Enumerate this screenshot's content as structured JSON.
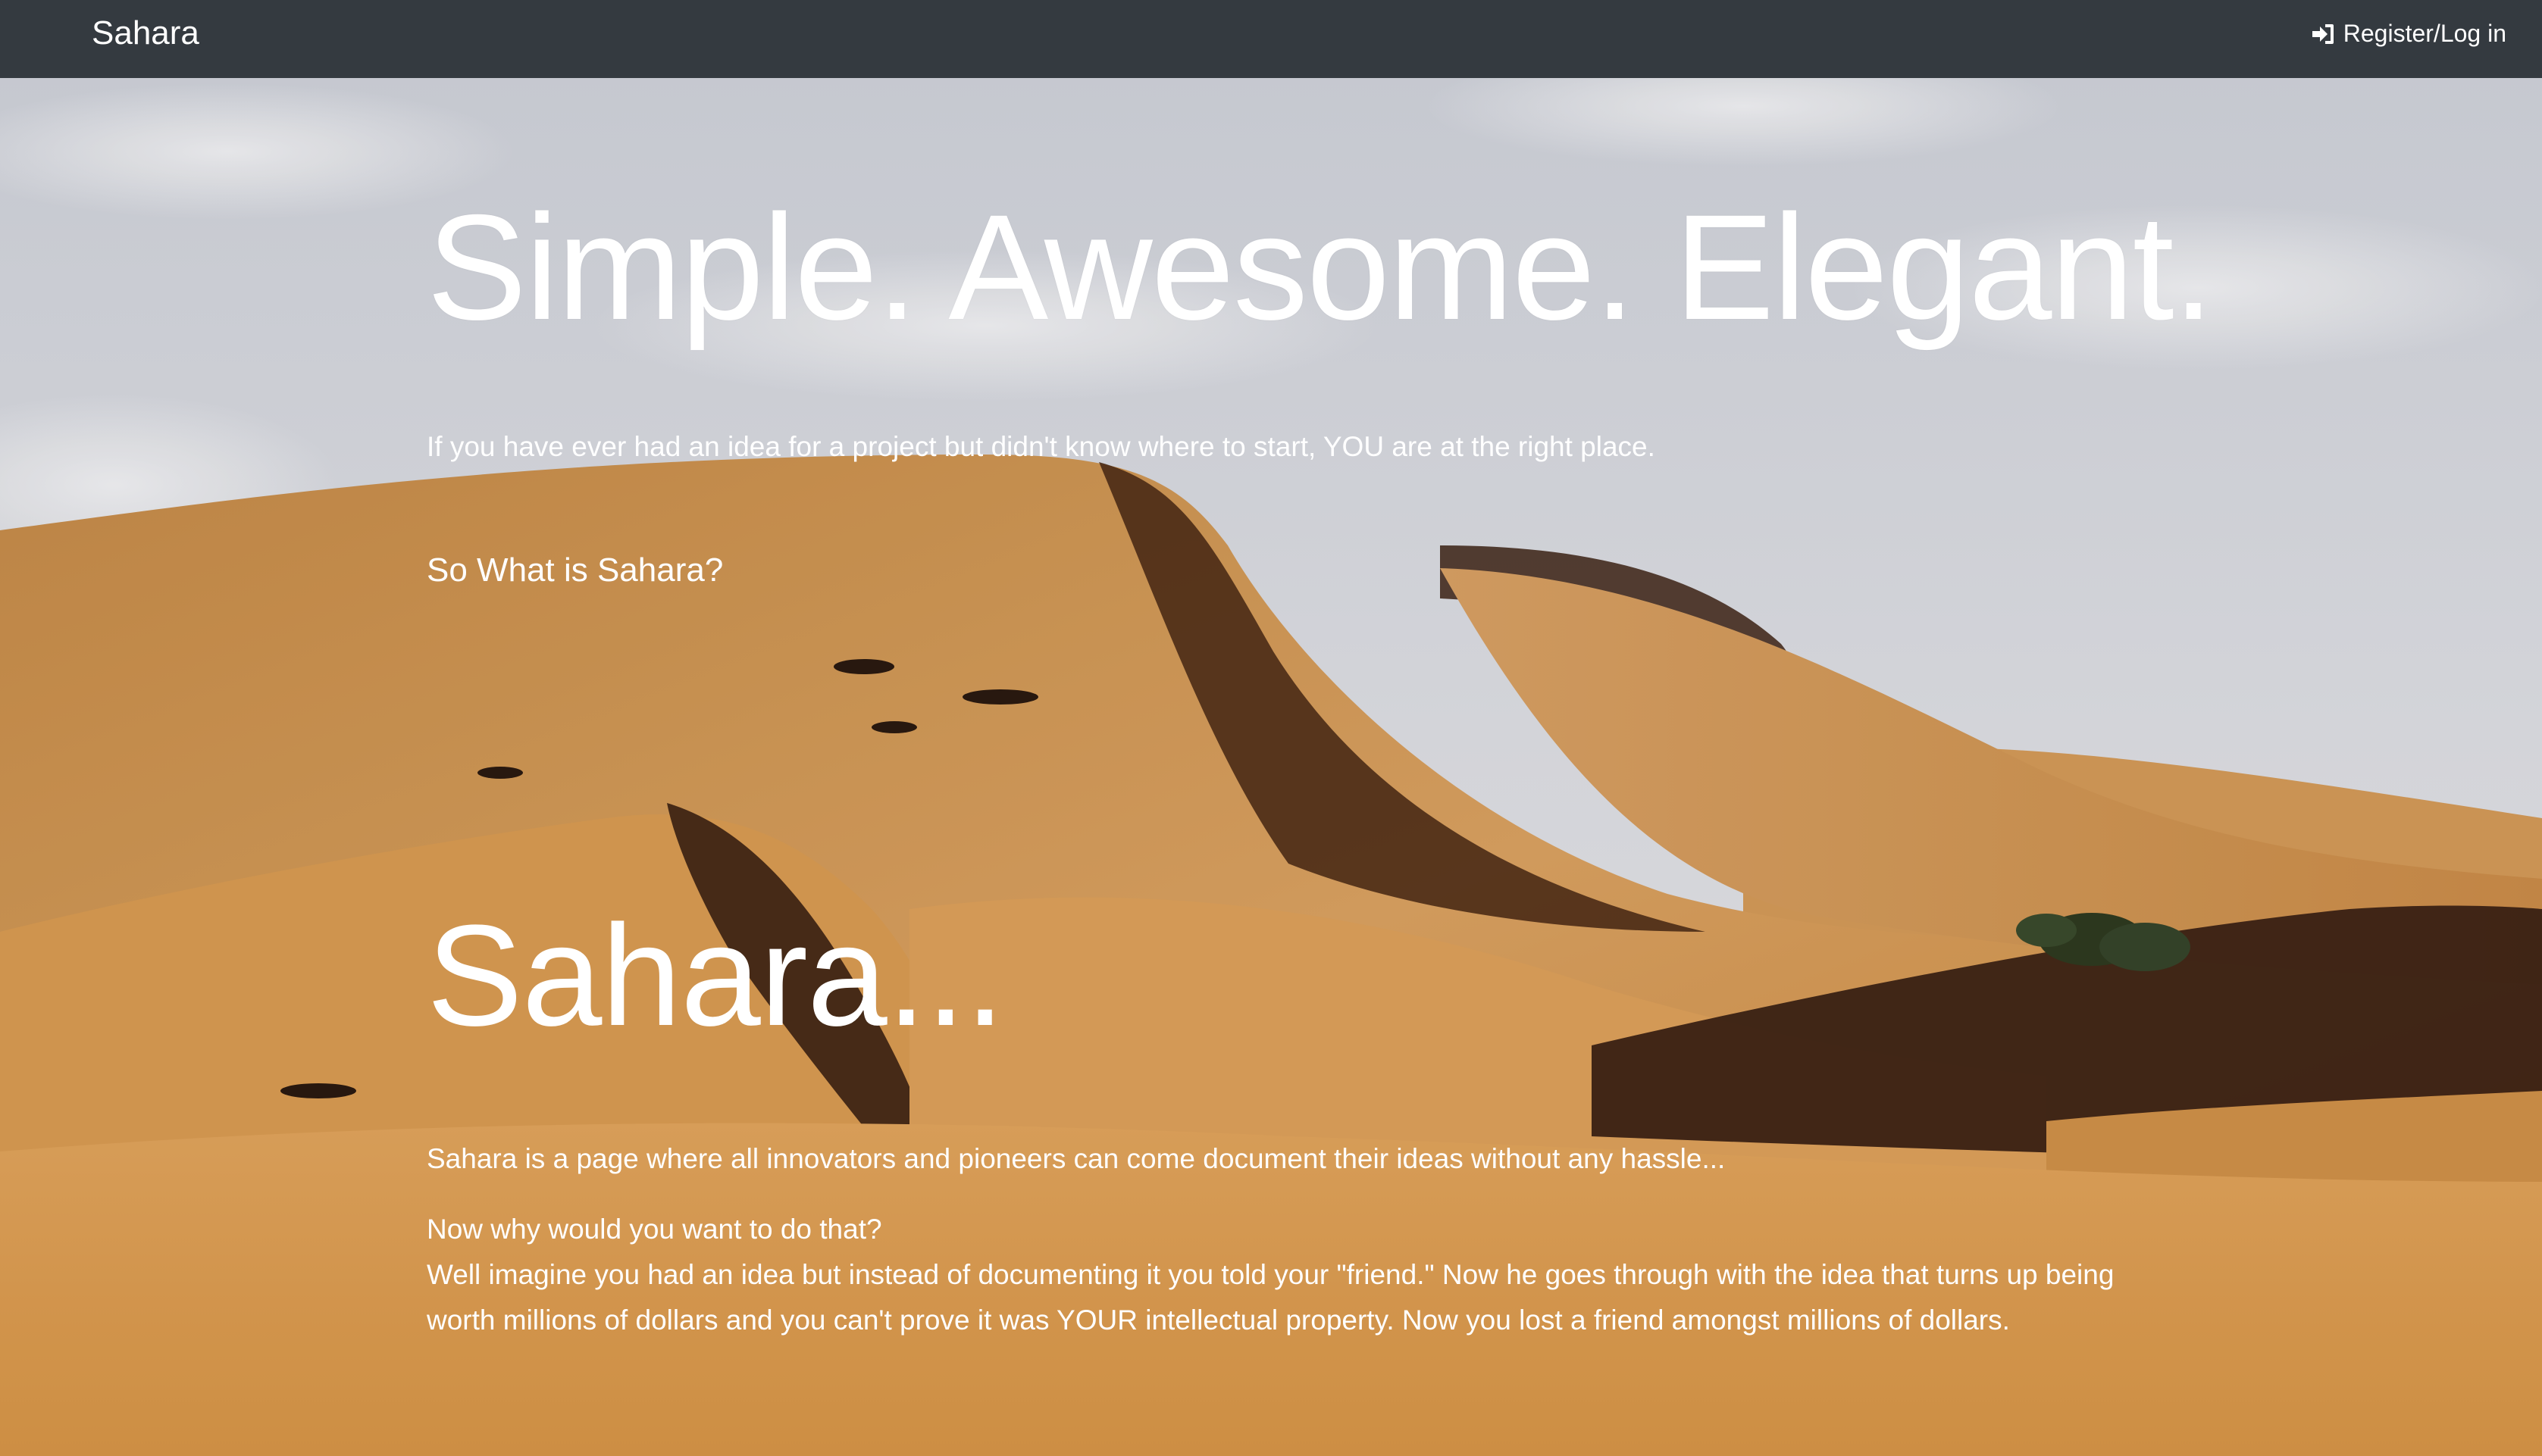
{
  "navbar": {
    "brand": "Sahara",
    "login_label": "Register/Log in",
    "login_icon": "sign-in-icon",
    "background_color": "#343a40"
  },
  "hero": {
    "title": "Simple. Awesome. Elegant.",
    "lead": "If you have ever had an idea for a project but didn't know where to start, YOU are at the right place.",
    "question": "So What is Sahara?"
  },
  "about": {
    "title": "Sahara...",
    "description": "Sahara is a page where all innovators and pioneers can come document their ideas without any hassle...",
    "question": "Now why would you want to do that?",
    "story": "Well imagine you had an idea but instead of documenting it you told your \"friend.\" Now he goes through with the idea that turns up being worth millions of dollars and you can't prove it was YOUR intellectual property. Now you lost a friend amongst millions of dollars."
  },
  "background": {
    "scene": "desert sand dunes under cloudy sky",
    "sky_color": "#d4d6dc",
    "sand_light": "#e3a55a",
    "sand_mid": "#c98a3e",
    "sand_shadow": "#3b2315"
  }
}
